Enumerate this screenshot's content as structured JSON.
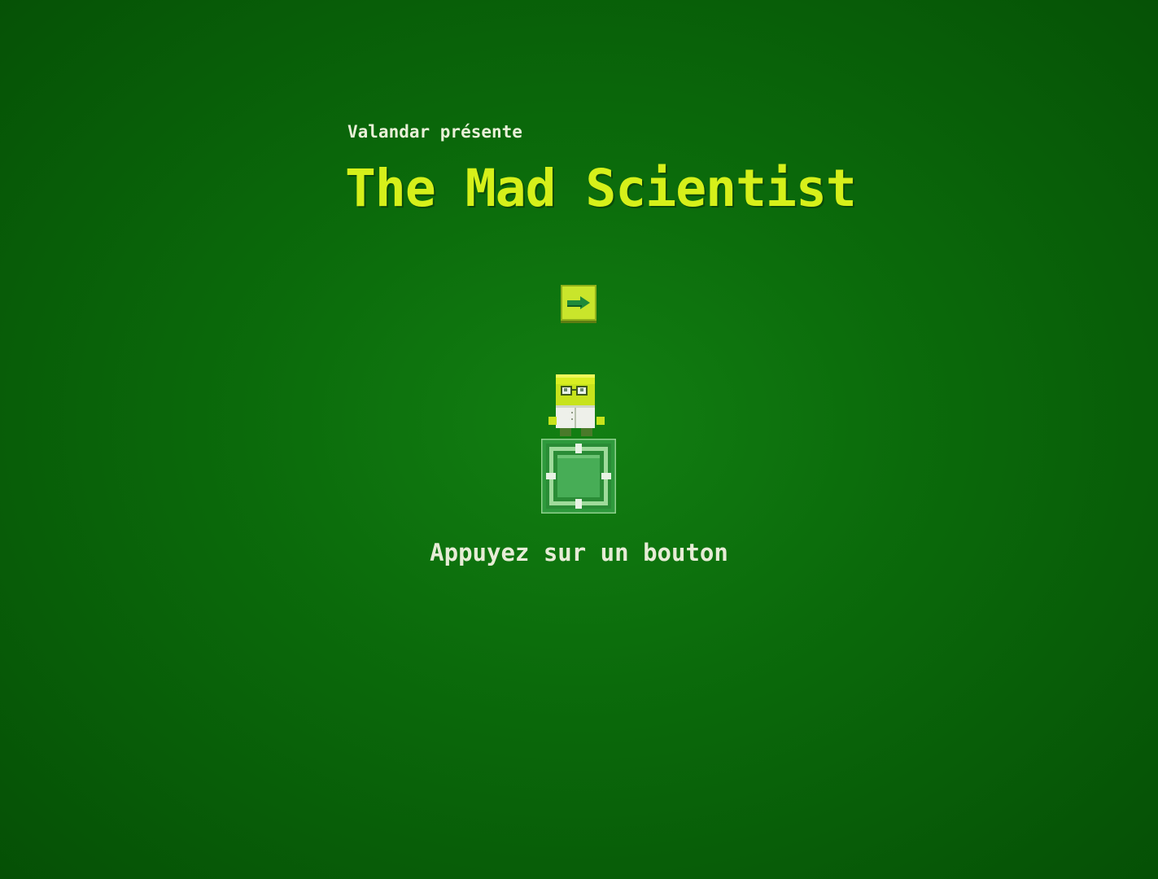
{
  "intro": {
    "presenter_text": "Valandar présente",
    "game_title": "The Mad Scientist",
    "prompt_text": "Appuyez sur un bouton"
  },
  "icons": {
    "key": "arrow-right-icon",
    "character": "mad-scientist-sprite",
    "platform": "green-block-platform"
  },
  "colors": {
    "background": "#0b6b0b",
    "title": "#d6f01a",
    "text": "#e9f0d8",
    "key_fill": "#c9e52b"
  }
}
